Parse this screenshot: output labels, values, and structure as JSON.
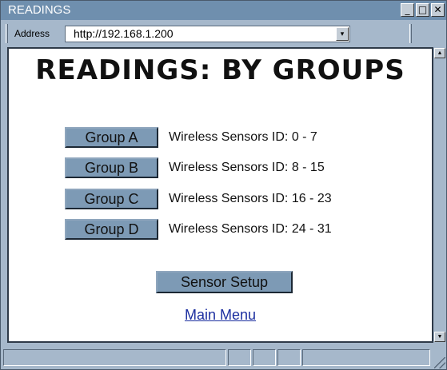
{
  "window": {
    "title": "READINGS",
    "controls": {
      "minimize": "_",
      "maximize": "□",
      "close": "✕"
    }
  },
  "address_bar": {
    "label": "Address",
    "url": "http://192.168.1.200",
    "dropdown_glyph": "▾"
  },
  "page": {
    "title": "READINGS: BY GROUPS",
    "groups": [
      {
        "button": "Group A",
        "description": "Wireless Sensors ID:  0 - 7"
      },
      {
        "button": "Group B",
        "description": "Wireless Sensors ID:  8 - 15"
      },
      {
        "button": "Group C",
        "description": "Wireless Sensors ID:  16 - 23"
      },
      {
        "button": "Group D",
        "description": "Wireless Sensors ID:  24 - 31"
      }
    ],
    "setup_button": "Sensor Setup",
    "main_menu_link": "Main Menu"
  },
  "scrollbar": {
    "up_glyph": "▲",
    "down_glyph": "▼"
  },
  "colors": {
    "chrome": "#a6b8cb",
    "titlebar": "#6f8fae",
    "button": "#7d9ab5",
    "link": "#1c2fa0"
  }
}
